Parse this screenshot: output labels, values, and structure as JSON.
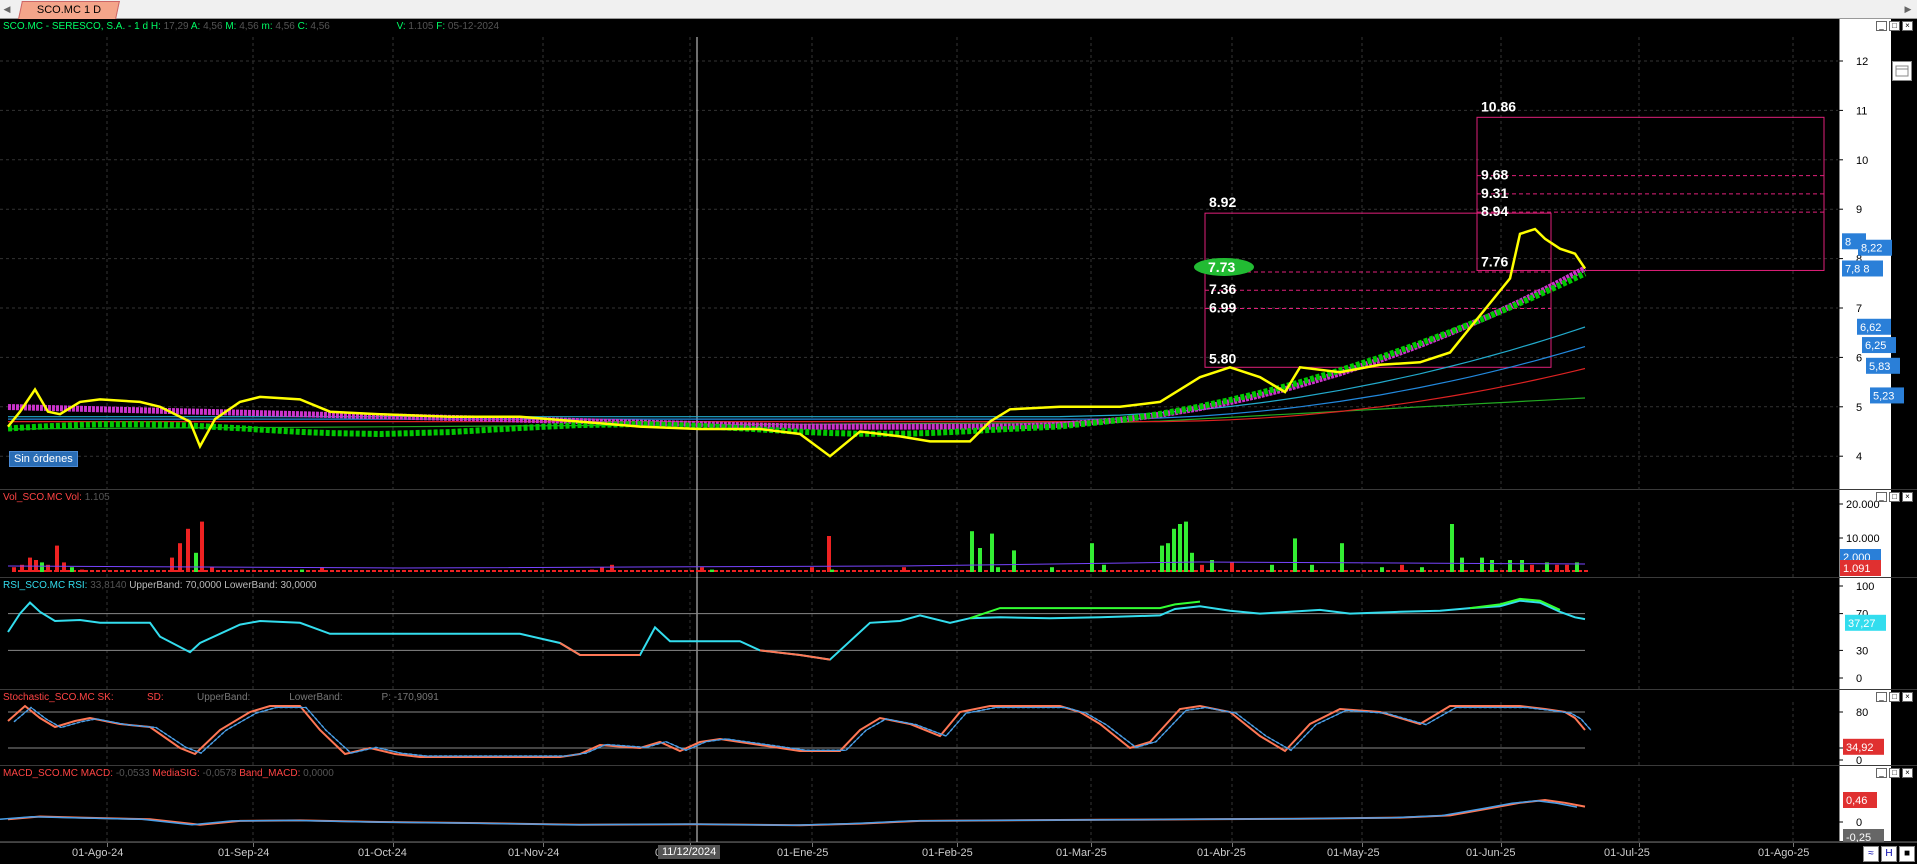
{
  "tab": {
    "label": "SCO.MC 1 D"
  },
  "main": {
    "title_sym": "SCO.MC - SERESCO, S.A. - 1 d",
    "h_label": "H:",
    "h_val": "17,29",
    "a_label": "A:",
    "a_val": "4,56",
    "m_label": "M:",
    "m_val": "4,56",
    "mi_label": "m:",
    "mi_val": "4,56",
    "c_label": "C:",
    "c_val": "4,56",
    "v_label": "V:",
    "v_val": "1.105",
    "f_label": "F:",
    "f_val": "05-12-2024",
    "badge": "Sin órdenes",
    "price_ticks": [
      "12",
      "11",
      "10",
      "9",
      "8",
      "7",
      "6",
      "5",
      "4"
    ],
    "levels_left": {
      "top": "8.92",
      "mid1": "7.73",
      "mid2": "7.36",
      "mid3": "6.99",
      "bottom": "5.80"
    },
    "levels_right": {
      "top": "10.86",
      "l1": "9.68",
      "l2": "9.31",
      "l3": "8.94",
      "bottom": "7.76"
    },
    "tags": {
      "t1": "8",
      "t2": "8,22",
      "t3": "7,8 8",
      "t4": "6,62",
      "t5": "6,25",
      "t6": "5,83",
      "t7": "5,23"
    }
  },
  "vol": {
    "title": "Vol_SCO.MC",
    "vol_label": "Vol:",
    "vol_val": "1.105",
    "ticks": [
      "20.000",
      "10.000"
    ],
    "tag_top": "2.000",
    "tag_bottom": "1.091"
  },
  "rsi": {
    "title": "RSI_SCO.MC",
    "rsi_label": "RSI:",
    "rsi_val": "33,8140",
    "ub_label": "UpperBand:",
    "ub_val": "70,0000",
    "lb_label": "LowerBand:",
    "lb_val": "30,0000",
    "ticks": [
      "100",
      "70",
      "30",
      "0"
    ],
    "tag": "37,27"
  },
  "stoch": {
    "title": "Stochastic_SCO.MC",
    "sk_label": "SK:",
    "sd_label": "SD:",
    "ub_label": "UpperBand:",
    "lb_label": "LowerBand:",
    "p_label": "P:",
    "p_val": "-170,9091",
    "ticks": [
      "80",
      "20",
      "0"
    ],
    "tag": "34,92"
  },
  "macd": {
    "title": "MACD_SCO.MC",
    "macd_label": "MACD:",
    "macd_val": "-0,0533",
    "sig_label": "MediaSIG:",
    "sig_val": "-0,0578",
    "band_label": "Band_MACD:",
    "band_val": "0,0000",
    "ticks": [
      "0"
    ],
    "tag": "0,46",
    "tag2": "-0,25"
  },
  "dates": {
    "labels": [
      "01-Ago-24",
      "01-Sep-24",
      "01-Oct-24",
      "01-Nov-24",
      "01-Dic-24",
      "01-Ene-25",
      "01-Feb-25",
      "01-Mar-25",
      "01-Abr-25",
      "01-May-25",
      "01-Jun-25",
      "01-Jul-25",
      "01-Ago-25"
    ],
    "cursor": "11/12/2024"
  },
  "colors": {
    "price": "#ffff00",
    "ma_green": "#00c800",
    "ma_magenta": "#cc33cc",
    "box": "#e0207a",
    "rsi_up": "#33ff33",
    "rsi_mid": "#33ddee",
    "rsi_down": "#ff7755",
    "vol_up": "#33ee33",
    "vol_down": "#ee2222",
    "tag_blue": "#2a7fd8",
    "tag_red": "#e03030"
  },
  "icons": {
    "settings": "gear-icon",
    "minimize": "minimize-icon",
    "maximize": "maximize-icon",
    "close": "close-icon"
  }
}
